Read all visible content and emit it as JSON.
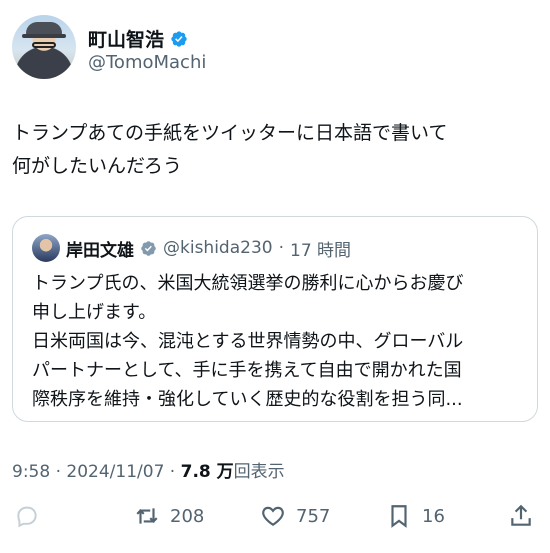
{
  "author": {
    "display_name": "町山智浩",
    "handle": "@TomoMachi",
    "verified_icon": "verified-badge"
  },
  "tweet": {
    "text": "トランプあての手紙をツイッターに日本語で書いて\n何がしたいんだろう"
  },
  "quote": {
    "display_name": "岸田文雄",
    "handle": "@kishida230",
    "separator": "·",
    "time": "17 時間",
    "lines": [
      "トランプ氏の、米国大統領選挙の勝利に心からお慶び",
      "申し上げます。",
      "日米両国は今、混沌とする世界情勢の中、グローバル",
      "パートナーとして、手に手を携えて自由で開かれた国",
      "際秩序を維持・強化していく歴史的な役割を担う同..."
    ]
  },
  "meta": {
    "time": "9:58",
    "date": "2024/11/07",
    "views_count": "7.8 万",
    "views_label": "回表示",
    "dot": "·"
  },
  "actions": {
    "reply_icon": "reply-icon",
    "retweet_count": "208",
    "like_count": "757",
    "bookmark_count": "16",
    "share_icon": "share-icon"
  },
  "colors": {
    "text": "#0f1419",
    "secondary": "#536471",
    "verified": "#1d9bf0",
    "border": "#cfd9de"
  }
}
